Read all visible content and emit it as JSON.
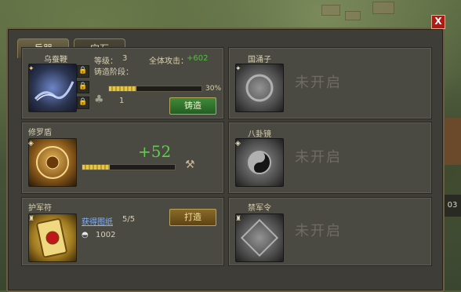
{
  "tabs": {
    "active": "兵器",
    "inactive": "宝石"
  },
  "close_label": "X",
  "weapons": [
    {
      "name": "乌蚕鞭",
      "level_label": "等级：",
      "level": "3",
      "attack_label": "全体攻击：",
      "attack_value": "+602",
      "forge_stage_label": "铸造阶段：",
      "progress_percent": 30,
      "progress_text": "30%",
      "material_count": "1",
      "button": "铸造",
      "lock_glyph": "🔒"
    },
    {
      "name": "修罗盾",
      "bonus": "+52",
      "progress_percent": 30
    },
    {
      "name": "护军符",
      "link_text": "获得图纸",
      "count": "5/5",
      "silver": "1002",
      "button": "打造"
    }
  ],
  "locked_items": [
    {
      "name": "国涌子",
      "status": "未开启"
    },
    {
      "name": "八卦镜",
      "status": "未开启"
    },
    {
      "name": "禁军令",
      "status": "未开启"
    }
  ],
  "colors": {
    "accent_green": "#4ec23a",
    "close_red": "#b01a12",
    "bar_gold": "#e6c64a"
  }
}
